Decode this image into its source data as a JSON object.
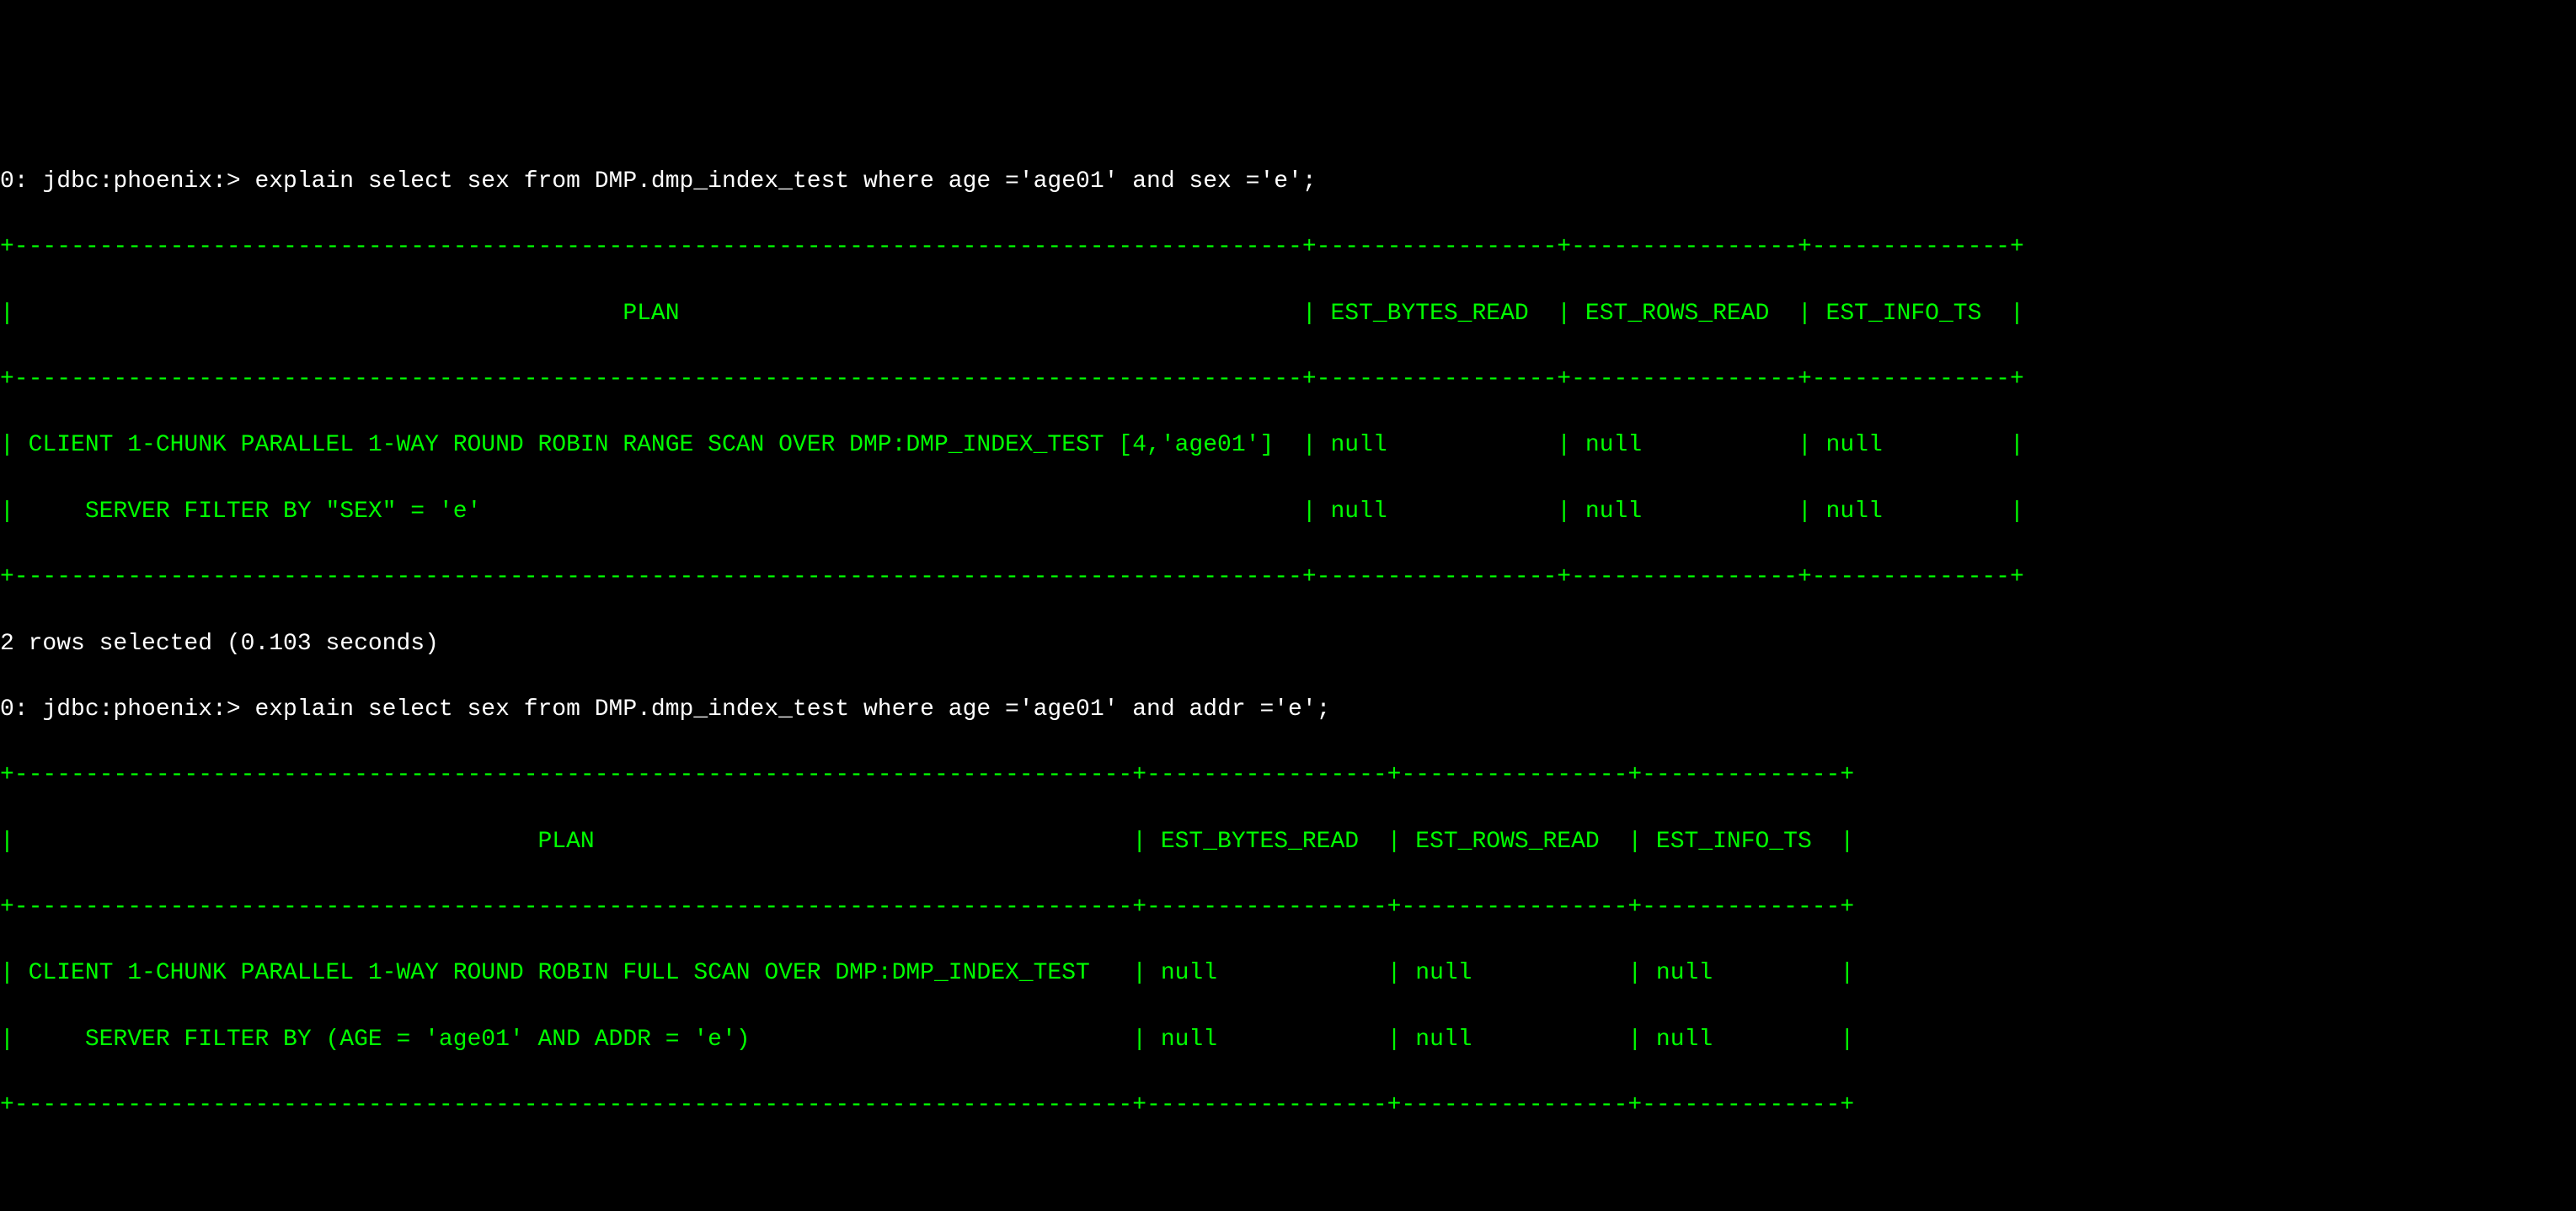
{
  "prompt_prefix": "0: jdbc:phoenix:> ",
  "query1": "explain select sex from DMP.dmp_index_test where age ='age01' and sex ='e';",
  "table1": {
    "border_top": "+-------------------------------------------------------------------------------------------+-----------------+----------------+--------------+",
    "header": "|                                           PLAN                                            | EST_BYTES_READ  | EST_ROWS_READ  | EST_INFO_TS  |",
    "border_mid": "+-------------------------------------------------------------------------------------------+-----------------+----------------+--------------+",
    "row1": "| CLIENT 1-CHUNK PARALLEL 1-WAY ROUND ROBIN RANGE SCAN OVER DMP:DMP_INDEX_TEST [4,'age01']  | null            | null           | null         |",
    "row2": "|     SERVER FILTER BY \"SEX\" = 'e'                                                          | null            | null           | null         |",
    "border_bottom": "+-------------------------------------------------------------------------------------------+-----------------+----------------+--------------+"
  },
  "rows_selected": "2 rows selected (0.103 seconds)",
  "query2": "explain select sex from DMP.dmp_index_test where age ='age01' and addr ='e';",
  "table2": {
    "border_top": "+-------------------------------------------------------------------------------+-----------------+----------------+--------------+",
    "header": "|                                     PLAN                                      | EST_BYTES_READ  | EST_ROWS_READ  | EST_INFO_TS  |",
    "border_mid": "+-------------------------------------------------------------------------------+-----------------+----------------+--------------+",
    "row1": "| CLIENT 1-CHUNK PARALLEL 1-WAY ROUND ROBIN FULL SCAN OVER DMP:DMP_INDEX_TEST   | null            | null           | null         |",
    "row2": "|     SERVER FILTER BY (AGE = 'age01' AND ADDR = 'e')                           | null            | null           | null         |",
    "border_bottom": "+-------------------------------------------------------------------------------+-----------------+----------------+--------------+"
  }
}
